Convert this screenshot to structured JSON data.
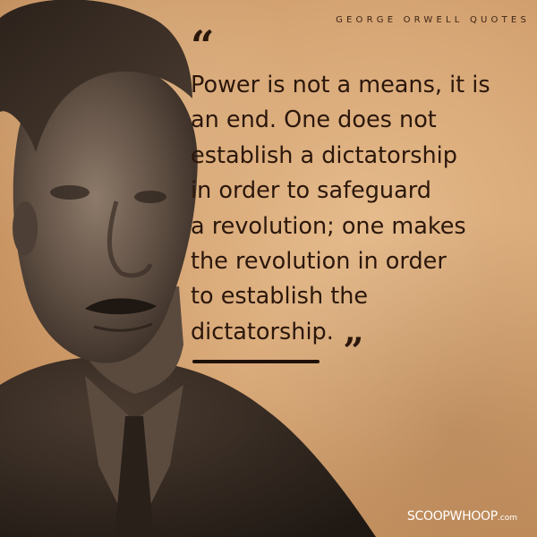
{
  "header": {
    "title": "GEORGE ORWELL QUOTES"
  },
  "quote": {
    "open_mark": "“",
    "close_mark": "„",
    "lines": [
      "Power is not a means, it is",
      "an end. One does not",
      "establish a dictatorship",
      "in order to safeguard",
      "a revolution; one makes",
      "the revolution in order",
      "to establish the",
      "dictatorship."
    ]
  },
  "brand": {
    "name": "SCOOPWHOOP",
    "suffix": ".com"
  },
  "colors": {
    "background": "#d6a574",
    "text": "#2b170b",
    "photo": "#3a2a1f"
  }
}
